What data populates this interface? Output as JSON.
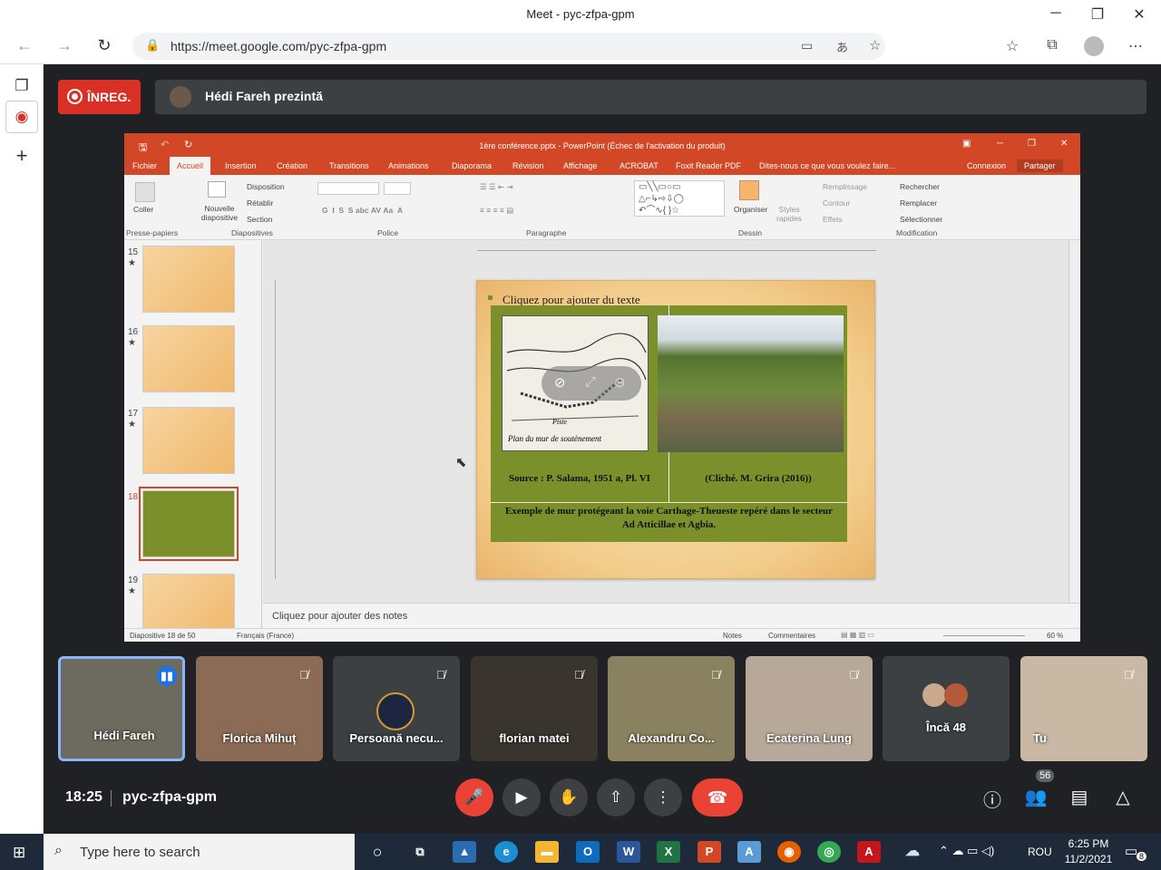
{
  "window": {
    "title": "Meet - pyc-zfpa-gpm",
    "minimize": "─",
    "maximize": "❐",
    "close": "✕"
  },
  "browser": {
    "url": "https://meet.google.com/pyc-zfpa-gpm",
    "back": "←",
    "forward": "→",
    "reload": "↻"
  },
  "meet": {
    "recording_label": "ÎNREG.",
    "presenter_text": "Hédi Fareh prezintă",
    "time": "18:25",
    "meeting_code": "pyc-zfpa-gpm",
    "people_count": "56"
  },
  "powerpoint": {
    "title": "1ère conférence.pptx - PowerPoint (Échec de l'activation du produit)",
    "tabs": [
      "Fichier",
      "Accueil",
      "Insertion",
      "Création",
      "Transitions",
      "Animations",
      "Diaporama",
      "Révision",
      "Affichage",
      "ACROBAT",
      "Foxit Reader PDF"
    ],
    "tell_me": "Dites-nous ce que vous voulez faire...",
    "connexion": "Connexion",
    "share": "Partager",
    "ribbon": {
      "groups": [
        "Presse-papiers",
        "Diapositives",
        "Police",
        "Paragraphe",
        "Dessin",
        "Modification"
      ],
      "coller": "Coller",
      "nouvelle": "Nouvelle diapositive",
      "disposition": "Disposition",
      "retablir": "Rétablir",
      "section": "Section",
      "organiser": "Organiser",
      "styles": "Styles rapides",
      "remplissage": "Remplissage",
      "contour": "Contour",
      "effets": "Effets",
      "rechercher": "Rechercher",
      "remplacer": "Remplacer",
      "selectionner": "Sélectionner"
    },
    "thumbnails": [
      {
        "num": "15",
        "star": "★"
      },
      {
        "num": "16",
        "star": "★"
      },
      {
        "num": "17",
        "star": "★"
      },
      {
        "num": "18",
        "star": ""
      },
      {
        "num": "19",
        "star": "★"
      }
    ],
    "slide": {
      "placeholder": "Cliquez pour ajouter du texte",
      "map_label": "Plan du mur de soutènement",
      "map_piste": "Piste",
      "source_left": "Source : P. Salama, 1951 a, Pl. VI",
      "source_right": "(Cliché. M. Grira (2016))",
      "caption": "Exemple de mur protégeant la voie Carthage-Theueste repéré dans le secteur Ad Atticillae et Agbia."
    },
    "notes_placeholder": "Cliquez pour ajouter des notes",
    "status": {
      "slide": "Diapositive 18 de 50",
      "lang": "Français (France)",
      "notes": "Notes",
      "comments": "Commentaires",
      "zoom": "60 %"
    }
  },
  "participants": [
    {
      "name": "Hédi Fareh",
      "bg": "#6d6a5f",
      "speaking": true
    },
    {
      "name": "Florica Mihuț",
      "bg": "#8b6b55"
    },
    {
      "name": "Persoană necu...",
      "bg": "#3c4043"
    },
    {
      "name": "florian matei",
      "bg": "#3a342f"
    },
    {
      "name": "Alexandru Co...",
      "bg": "#8a8160"
    },
    {
      "name": "Ecaterina Lung",
      "bg": "#b8a89a"
    },
    {
      "name": "Încă 48",
      "bg": "#3c4043"
    },
    {
      "name": "Tu",
      "bg": "#c9b8a3"
    }
  ],
  "taskbar": {
    "search_placeholder": "Type here to search",
    "lang": "ROU",
    "clock_time": "6:25 PM",
    "clock_date": "11/2/2021",
    "notif_count": "8"
  }
}
